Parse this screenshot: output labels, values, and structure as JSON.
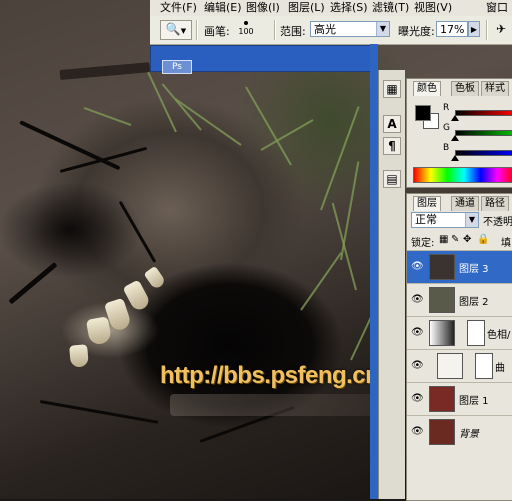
{
  "menu": [
    "文件(F)",
    "编辑(E)",
    "图像(I)",
    "图层(L)",
    "选择(S)",
    "滤镜(T)",
    "视图(V)",
    "窗口"
  ],
  "options": {
    "brush_label": "画笔:",
    "brush_size": "100",
    "range_label": "范围:",
    "range_value": "高光",
    "exposure_label": "曝光度:",
    "exposure_value": "17%"
  },
  "document_tab": "Ps",
  "color_panel": {
    "tabs": [
      "颜色",
      "色板",
      "样式"
    ],
    "channels": [
      "R",
      "G",
      "B"
    ],
    "foreground": "#000000",
    "background": "#ffffff"
  },
  "layers_panel": {
    "tabs": [
      "图层",
      "通道",
      "路径"
    ],
    "blend_mode": "正常",
    "opacity_label": "不透明",
    "lock_label": "锁定:",
    "fill_label": "填",
    "layers": [
      {
        "name": "图层 3",
        "active": true,
        "thumb": "#3a3330"
      },
      {
        "name": "图层 2",
        "active": false,
        "thumb": "#5a5a4a"
      },
      {
        "name": "色相/",
        "active": false,
        "thumb": "#ffffff"
      },
      {
        "name": "曲",
        "active": false,
        "thumb": "#ffffff"
      },
      {
        "name": "图层 1",
        "active": false,
        "thumb": "#7a2a24"
      },
      {
        "name": "背景",
        "active": false,
        "thumb": "#6a2a22"
      }
    ]
  },
  "watermark": "http://bbs.psfeng.cn/",
  "accent": "#3169c6"
}
